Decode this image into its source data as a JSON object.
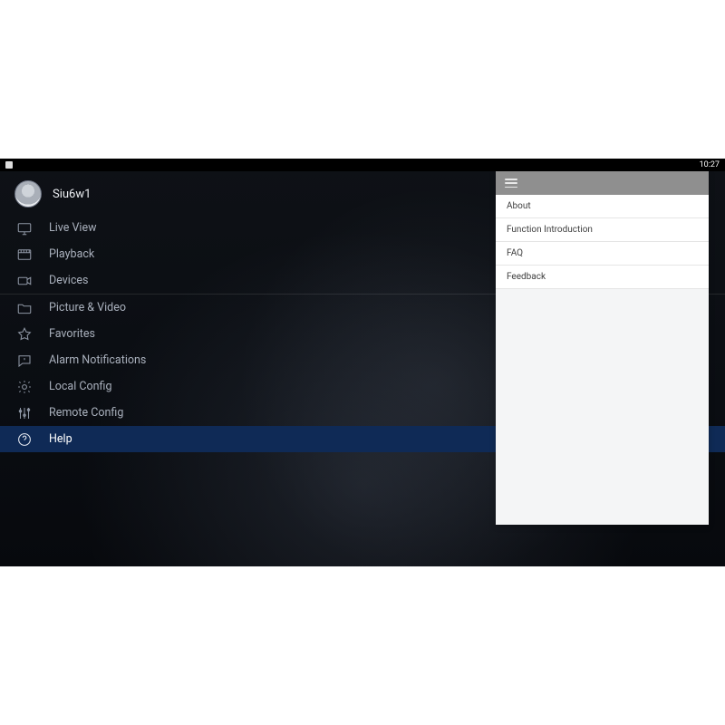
{
  "statusbar": {
    "time": "10:27"
  },
  "user": {
    "name": "Siu6w1"
  },
  "sidebar": {
    "items": [
      {
        "label": "Live View"
      },
      {
        "label": "Playback"
      },
      {
        "label": "Devices"
      },
      {
        "label": "Picture & Video"
      },
      {
        "label": "Favorites"
      },
      {
        "label": "Alarm Notifications"
      },
      {
        "label": "Local Config"
      },
      {
        "label": "Remote Config"
      },
      {
        "label": "Help"
      }
    ],
    "selected_index": 8,
    "separator_after_index": 2
  },
  "help_panel": {
    "items": [
      {
        "label": "About"
      },
      {
        "label": "Function Introduction"
      },
      {
        "label": "FAQ"
      },
      {
        "label": "Feedback"
      }
    ]
  },
  "colors": {
    "selected_bg": "#0f2a56",
    "panel_header": "#8f8f8f"
  }
}
